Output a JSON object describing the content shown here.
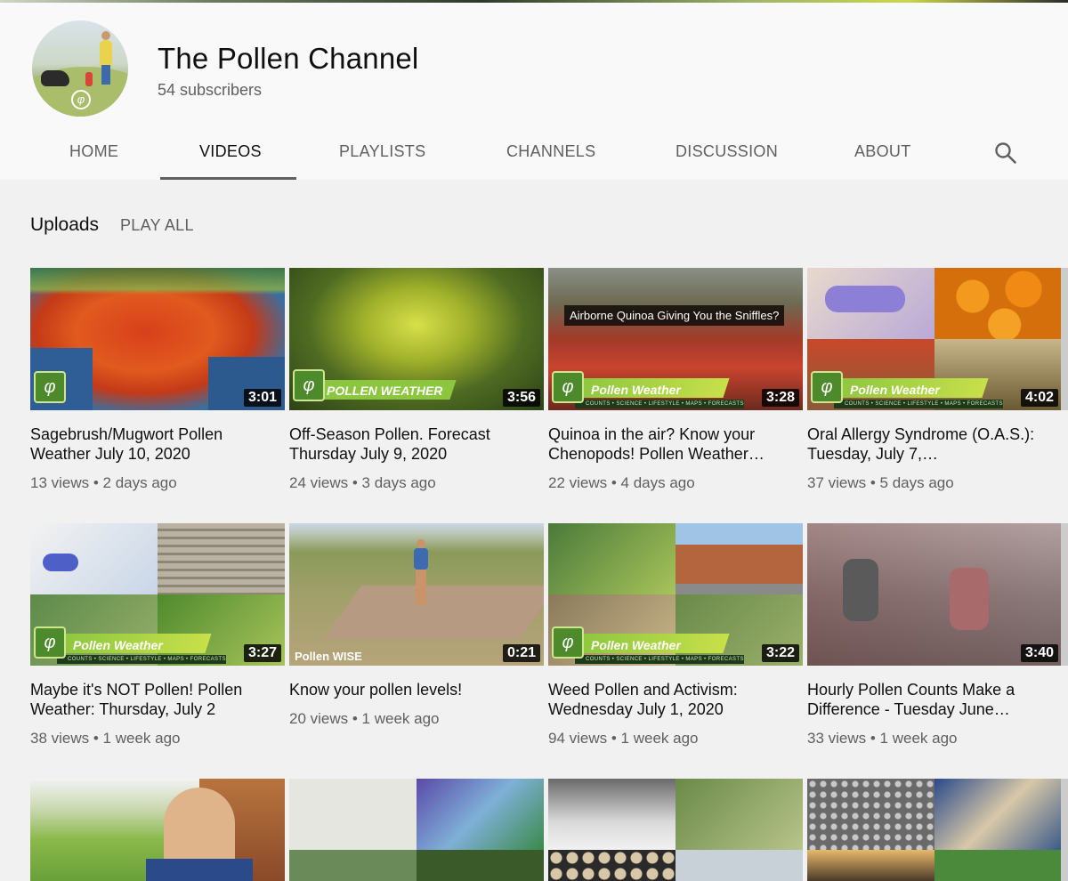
{
  "channel": {
    "name": "The Pollen Channel",
    "subscribers": "54 subscribers"
  },
  "tabs": [
    {
      "label": "HOME"
    },
    {
      "label": "VIDEOS",
      "active": true
    },
    {
      "label": "PLAYLISTS"
    },
    {
      "label": "CHANNELS"
    },
    {
      "label": "DISCUSSION"
    },
    {
      "label": "ABOUT"
    }
  ],
  "section": {
    "title": "Uploads",
    "play_all": "PLAY ALL"
  },
  "videos": [
    {
      "title": "Sagebrush/Mugwort Pollen Weather July 10, 2020",
      "views": "13 views",
      "age": "2 days ago",
      "duration": "3:01"
    },
    {
      "title": "Off-Season Pollen. Forecast Thursday July 9, 2020",
      "views": "24 views",
      "age": "3 days ago",
      "duration": "3:56",
      "banner": "POLLEN WEATHER"
    },
    {
      "title": "Quinoa in the air? Know your Chenopods! Pollen Weather…",
      "views": "22 views",
      "age": "4 days ago",
      "duration": "3:28",
      "caption": "Airborne Quinoa Giving You the Sniffles?",
      "banner": "Pollen Weather",
      "sub": "COUNTS • SCIENCE • LIFESTYLE • MAPS • FORECASTS"
    },
    {
      "title": "Oral Allergy Syndrome (O.A.S.): Tuesday, July 7,…",
      "views": "37 views",
      "age": "5 days ago",
      "duration": "4:02",
      "banner": "Pollen Weather",
      "sub": "COUNTS • SCIENCE • LIFESTYLE • MAPS • FORECASTS"
    },
    {
      "title": "Maybe it's NOT Pollen! Pollen Weather: Thursday, July 2",
      "views": "38 views",
      "age": "1 week ago",
      "duration": "3:27",
      "banner": "Pollen Weather",
      "sub": "COUNTS • SCIENCE • LIFESTYLE • MAPS • FORECASTS"
    },
    {
      "title": "Know your pollen levels!",
      "views": "20 views",
      "age": "1 week ago",
      "duration": "0:21",
      "badge": "Pollen WISE"
    },
    {
      "title": "Weed Pollen and Activism: Wednesday July 1, 2020",
      "views": "94 views",
      "age": "1 week ago",
      "duration": "3:22",
      "banner": "Pollen Weather",
      "sub": "COUNTS • SCIENCE • LIFESTYLE • MAPS • FORECASTS"
    },
    {
      "title": "Hourly Pollen Counts Make a Difference - Tuesday June…",
      "views": "33 views",
      "age": "1 week ago",
      "duration": "3:40"
    }
  ],
  "colors": {
    "accent_green": "#8cc63f",
    "text_secondary": "#606060",
    "background": "#f1f1f1"
  }
}
